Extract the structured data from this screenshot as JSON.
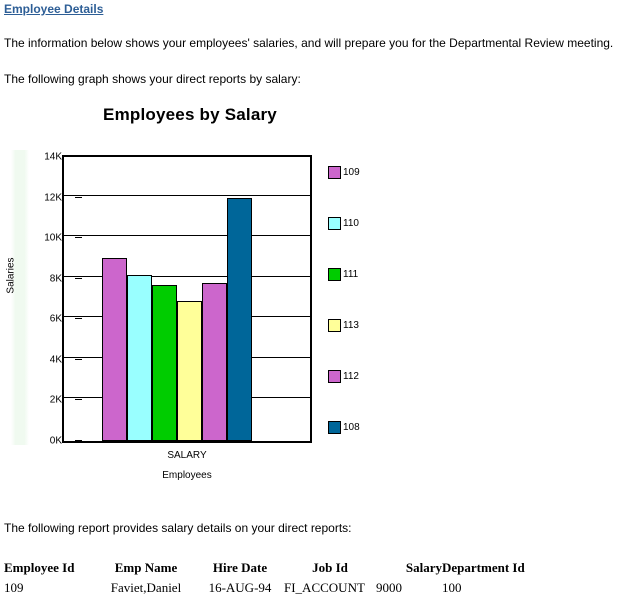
{
  "page": {
    "title": "Employee Details",
    "paragraph_intro": "The information below shows your employees' salaries, and will prepare you for the Departmental Review meeting.",
    "paragraph_graph": "The following graph shows your direct reports by salary:",
    "paragraph_report": "The following report provides salary details on your direct reports:"
  },
  "chart_data": {
    "type": "bar",
    "title": "Employees by Salary",
    "xlabel": "Employees",
    "ylabel": "Salaries",
    "categories": [
      "SALARY"
    ],
    "x_category_label": "SALARY",
    "ylim": [
      0,
      14000
    ],
    "ytick_labels": [
      "14K",
      "12K",
      "10K",
      "8K",
      "6K",
      "4K",
      "2K",
      "0K"
    ],
    "ytick_values": [
      14000,
      12000,
      10000,
      8000,
      6000,
      4000,
      2000,
      0
    ],
    "grid": true,
    "legend_position": "right",
    "series": [
      {
        "name": "109",
        "values": [
          9000
        ],
        "color": "#cc66cc"
      },
      {
        "name": "110",
        "values": [
          8200
        ],
        "color": "#99ffff"
      },
      {
        "name": "111",
        "values": [
          7700
        ],
        "color": "#00cc00"
      },
      {
        "name": "113",
        "values": [
          6900
        ],
        "color": "#ffff99"
      },
      {
        "name": "112",
        "values": [
          7800
        ],
        "color": "#cc66cc"
      },
      {
        "name": "108",
        "values": [
          12000
        ],
        "color": "#006699"
      }
    ]
  },
  "report": {
    "columns": [
      "Employee Id",
      "Emp Name",
      "Hire Date",
      "Job Id",
      "Salary",
      "Department Id"
    ],
    "rows": [
      {
        "employee_id": "109",
        "emp_name": "Faviet,Daniel",
        "hire_date": "16-AUG-94",
        "job_id": "FI_ACCOUNT",
        "salary": "9000",
        "department_id": "100"
      }
    ]
  }
}
